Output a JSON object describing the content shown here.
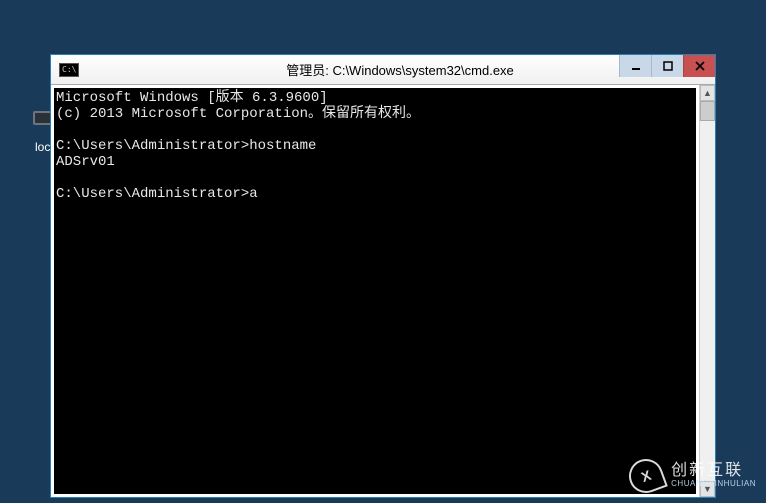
{
  "window": {
    "title": "管理员: C:\\Windows\\system32\\cmd.exe",
    "app_icon_text": "C:\\"
  },
  "console": {
    "line1": "Microsoft Windows [版本 6.3.9600]",
    "line2": "(c) 2013 Microsoft Corporation。保留所有权利。",
    "blank1": "",
    "prompt1": "C:\\Users\\Administrator>hostname",
    "out1": "ADSrv01",
    "blank2": "",
    "prompt2": "C:\\Users\\Administrator>a"
  },
  "desktop": {
    "icon_label": "locl"
  },
  "watermark": {
    "logo_text": "X",
    "brand_zh": "创新互联",
    "brand_py": "CHUANGXINHULIAN"
  }
}
